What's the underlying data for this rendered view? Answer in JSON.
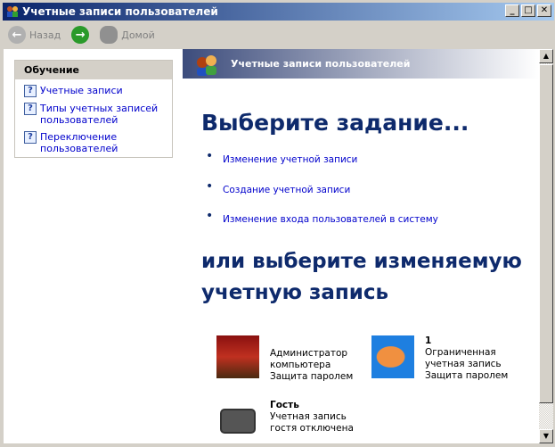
{
  "window": {
    "title": "Учетные записи пользователей"
  },
  "toolbar": {
    "back": "Назад",
    "home": "Домой"
  },
  "sidebar": {
    "header": "Обучение",
    "items": [
      {
        "label": "Учетные записи"
      },
      {
        "label": "Типы учетных записей пользователей"
      },
      {
        "label": "Переключение пользователей"
      }
    ]
  },
  "banner": {
    "title": "Учетные записи пользователей"
  },
  "main": {
    "heading1": "Выберите задание...",
    "tasks": [
      {
        "label": "Изменение учетной записи"
      },
      {
        "label": "Создание учетной записи"
      },
      {
        "label": "Изменение входа пользователей в систему"
      }
    ],
    "heading2a": "или выберите изменяемую",
    "heading2b": "учетную запись",
    "accounts": [
      {
        "name": "",
        "lines": [
          "Администратор",
          "компьютера",
          "Защита паролем"
        ]
      },
      {
        "name": "1",
        "lines": [
          "Ограниченная",
          "учетная запись",
          "Защита паролем"
        ]
      },
      {
        "name": "Гость",
        "lines": [
          "Учетная запись",
          "гостя отключена"
        ]
      }
    ]
  }
}
